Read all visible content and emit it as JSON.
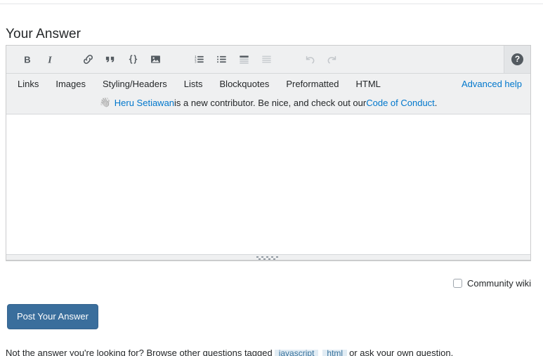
{
  "heading": "Your Answer",
  "toolbar": {
    "buttons": [
      {
        "name": "bold-icon",
        "label": "B",
        "state": "enabled"
      },
      {
        "name": "italic-icon",
        "label": "I",
        "state": "enabled"
      },
      {
        "name": "link-icon",
        "label": "Hyperlink",
        "state": "enabled"
      },
      {
        "name": "blockquote-icon",
        "label": "Blockquote",
        "state": "enabled"
      },
      {
        "name": "code-icon",
        "label": "{}",
        "state": "enabled"
      },
      {
        "name": "image-icon",
        "label": "Image",
        "state": "enabled"
      },
      {
        "name": "numbered-list-icon",
        "label": "Numbered List",
        "state": "enabled"
      },
      {
        "name": "bulleted-list-icon",
        "label": "Bulleted List",
        "state": "enabled"
      },
      {
        "name": "heading-icon",
        "label": "Heading",
        "state": "enabled"
      },
      {
        "name": "horizontal-rule-icon",
        "label": "Horizontal Rule",
        "state": "disabled"
      },
      {
        "name": "undo-icon",
        "label": "Undo",
        "state": "disabled"
      },
      {
        "name": "redo-icon",
        "label": "Redo",
        "state": "disabled"
      }
    ],
    "help_button_label": "?"
  },
  "help_links": {
    "items": [
      "Links",
      "Images",
      "Styling/Headers",
      "Lists",
      "Blockquotes",
      "Preformatted",
      "HTML"
    ],
    "advanced": "Advanced help"
  },
  "new_contributor": {
    "wave": "👋",
    "user": "Heru Setiawan",
    "text_middle": " is a new contributor. Be nice, and check out our ",
    "code_link": "Code of Conduct",
    "text_end": "."
  },
  "editor": {
    "value": "",
    "placeholder": ""
  },
  "community_wiki": {
    "label": "Community wiki",
    "checked": false
  },
  "post_button": {
    "label": "Post Your Answer"
  },
  "footer": {
    "prefix": "Not the answer you're looking for? Browse other questions tagged ",
    "tags": [
      "javascript",
      "html"
    ],
    "suffix": " or ask your own question."
  },
  "colors": {
    "link": "#0077cc",
    "button_blue": "#3a6e9c",
    "toolbar_bg": "#eff0f1",
    "icon": "#535a60",
    "icon_disabled": "#babfc4",
    "tag_bg": "#e1ecf4",
    "tag_text": "#39739d"
  }
}
